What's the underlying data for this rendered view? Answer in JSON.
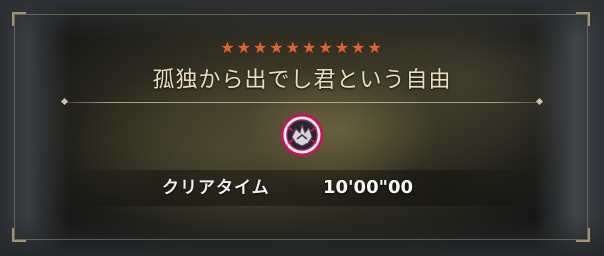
{
  "quest": {
    "rank_stars": "★★★★★★★★★★",
    "title": "孤独から出でし君という自由",
    "monster_icon": "monster-crest-icon"
  },
  "result": {
    "clear_time_label": "クリアタイム",
    "clear_time_value": "10'00\"00"
  },
  "colors": {
    "star": "#e3622b",
    "title_text": "#e9dcc0",
    "icon_ring": "#c2185b"
  }
}
